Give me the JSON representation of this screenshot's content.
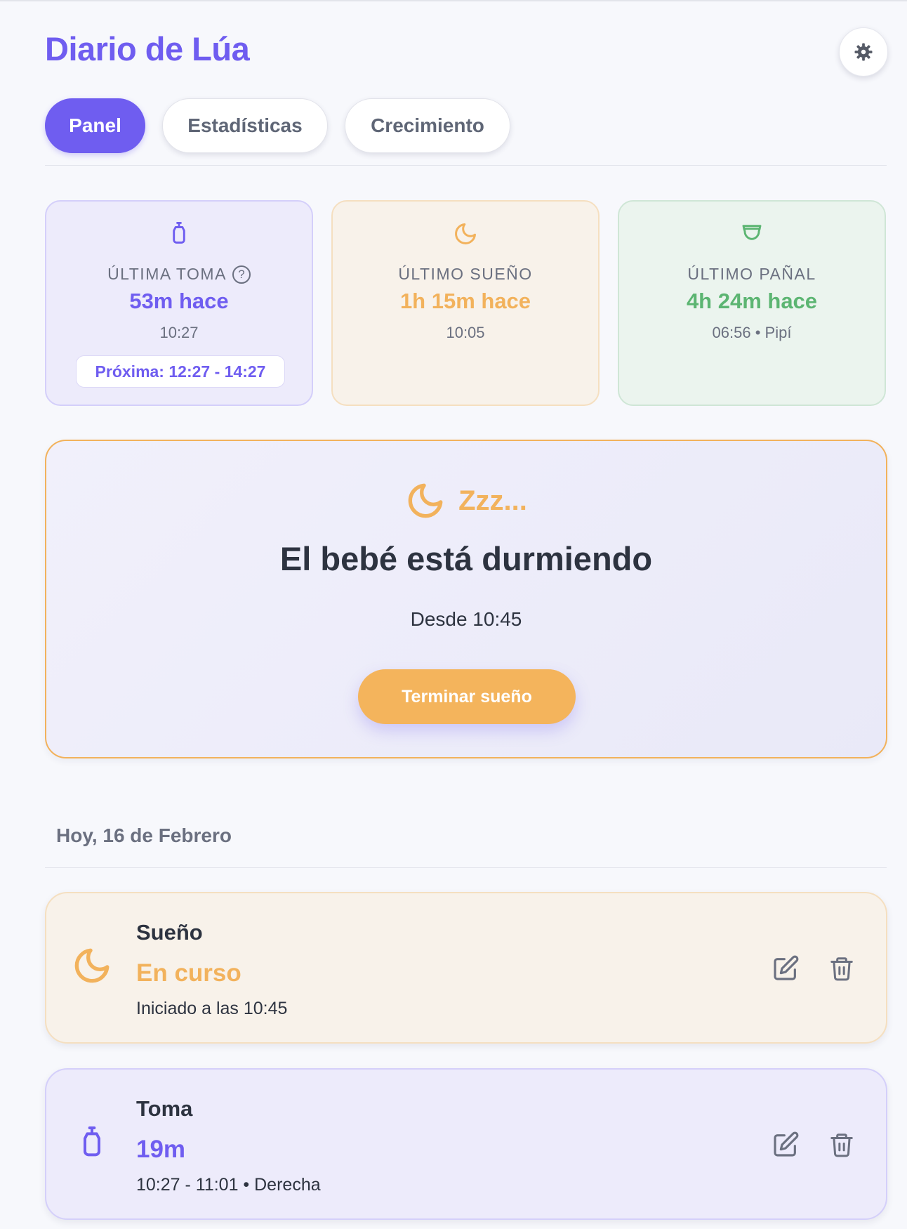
{
  "app": {
    "title": "Diario de Lúa"
  },
  "tabs": [
    {
      "label": "Panel",
      "active": true
    },
    {
      "label": "Estadísticas",
      "active": false
    },
    {
      "label": "Crecimiento",
      "active": false
    }
  ],
  "summary": {
    "feed": {
      "label": "ÚLTIMA TOMA",
      "help": "?",
      "value": "53m hace",
      "time": "10:27",
      "next": "Próxima: 12:27 - 14:27",
      "icon": "bottle-icon"
    },
    "sleep": {
      "label": "ÚLTIMO SUEÑO",
      "value": "1h 15m hace",
      "time": "10:05",
      "icon": "moon-icon"
    },
    "diaper": {
      "label": "ÚLTIMO PAÑAL",
      "value": "4h 24m hace",
      "time": "06:56 • Pipí",
      "icon": "diaper-icon"
    }
  },
  "sleep_banner": {
    "zzz": "Zzz...",
    "heading": "El bebé está durmiendo",
    "since": "Desde 10:45",
    "button": "Terminar sueño"
  },
  "today": {
    "heading": "Hoy, 16 de Febrero",
    "entries": [
      {
        "type": "Sueño",
        "value": "En curso",
        "detail": "Iniciado a las 10:45",
        "icon": "moon-icon"
      },
      {
        "type": "Toma",
        "value": "19m",
        "detail": "10:27 - 11:01 • Derecha",
        "icon": "bottle-icon"
      }
    ]
  },
  "colors": {
    "accent": "#6f5df0",
    "sleep": "#f2b25c",
    "diaper": "#5cb572",
    "text": "#2d3340",
    "muted": "#6b7080"
  }
}
